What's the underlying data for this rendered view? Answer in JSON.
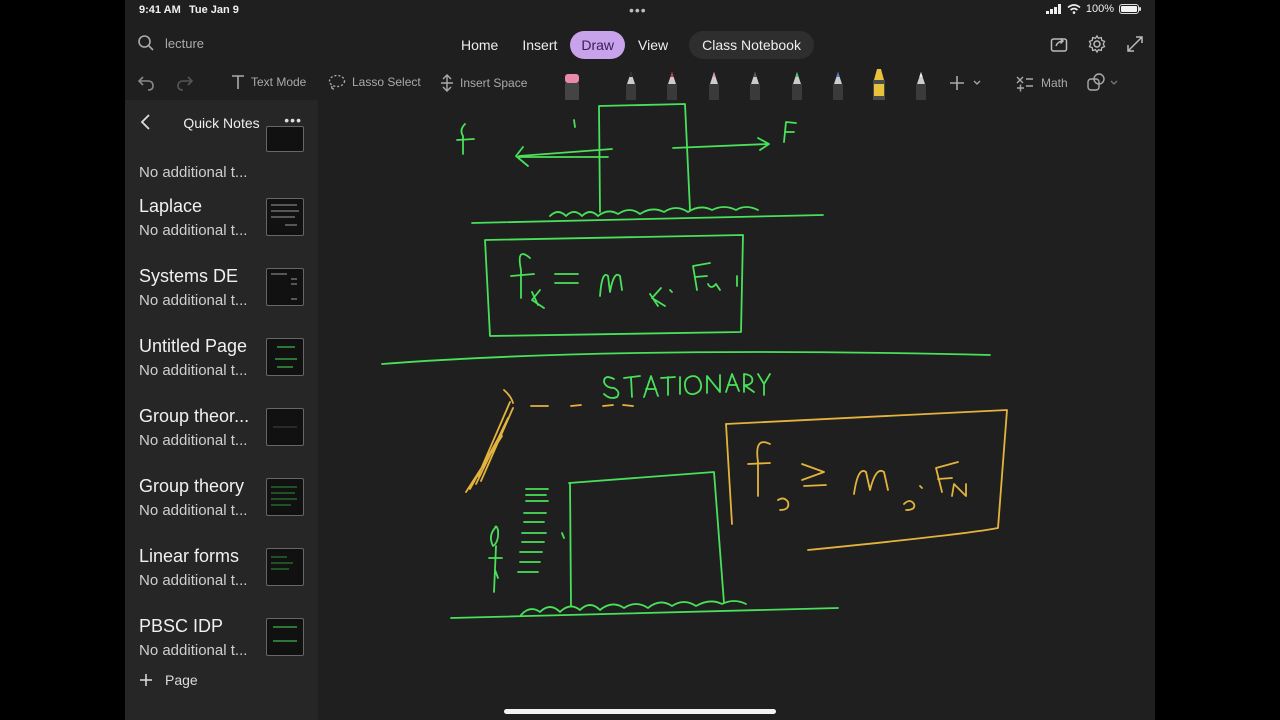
{
  "status": {
    "time": "9:41 AM",
    "date": "Tue Jan 9",
    "battery": "100%",
    "battery_level": 1.0
  },
  "search": {
    "placeholder": "lecture"
  },
  "tabs": [
    {
      "label": "Home"
    },
    {
      "label": "Insert"
    },
    {
      "label": "Draw"
    },
    {
      "label": "View"
    },
    {
      "label": "Class Notebook"
    }
  ],
  "draw_toolbar": {
    "text_mode": "Text Mode",
    "lasso_select": "Lasso Select",
    "insert_space": "Insert Space",
    "math": "Math",
    "pens": [
      {
        "name": "eraser",
        "color": "#e88aa8"
      },
      {
        "name": "pen-black",
        "color": "#2a2a2a"
      },
      {
        "name": "pen-red",
        "color": "#d8343c"
      },
      {
        "name": "pen-pink",
        "color": "#e88fcf"
      },
      {
        "name": "pen-gray",
        "color": "#3a3a3a"
      },
      {
        "name": "pen-green",
        "color": "#3fd35a"
      },
      {
        "name": "pen-blue",
        "color": "#4a7ed8"
      },
      {
        "name": "highlighter-yellow",
        "color": "#e8c23a"
      },
      {
        "name": "pen-white",
        "color": "#d0d0d0"
      }
    ]
  },
  "sidebar": {
    "title": "Quick Notes",
    "pages": [
      {
        "title": "",
        "subtitle": "No additional t..."
      },
      {
        "title": "Laplace",
        "subtitle": "No additional t..."
      },
      {
        "title": "Systems DE",
        "subtitle": "No additional t..."
      },
      {
        "title": "Untitled Page",
        "subtitle": "No additional t..."
      },
      {
        "title": "Group theor...",
        "subtitle": "No additional t..."
      },
      {
        "title": "Group theory",
        "subtitle": "No additional t..."
      },
      {
        "title": "Linear forms",
        "subtitle": "No additional t..."
      },
      {
        "title": "PBSC IDP",
        "subtitle": "No additional t..."
      }
    ],
    "add_page_label": "Page"
  },
  "colors": {
    "accent": "#c8a2ea",
    "ink_green": "#49e05a",
    "ink_yellow": "#e3b33d"
  }
}
